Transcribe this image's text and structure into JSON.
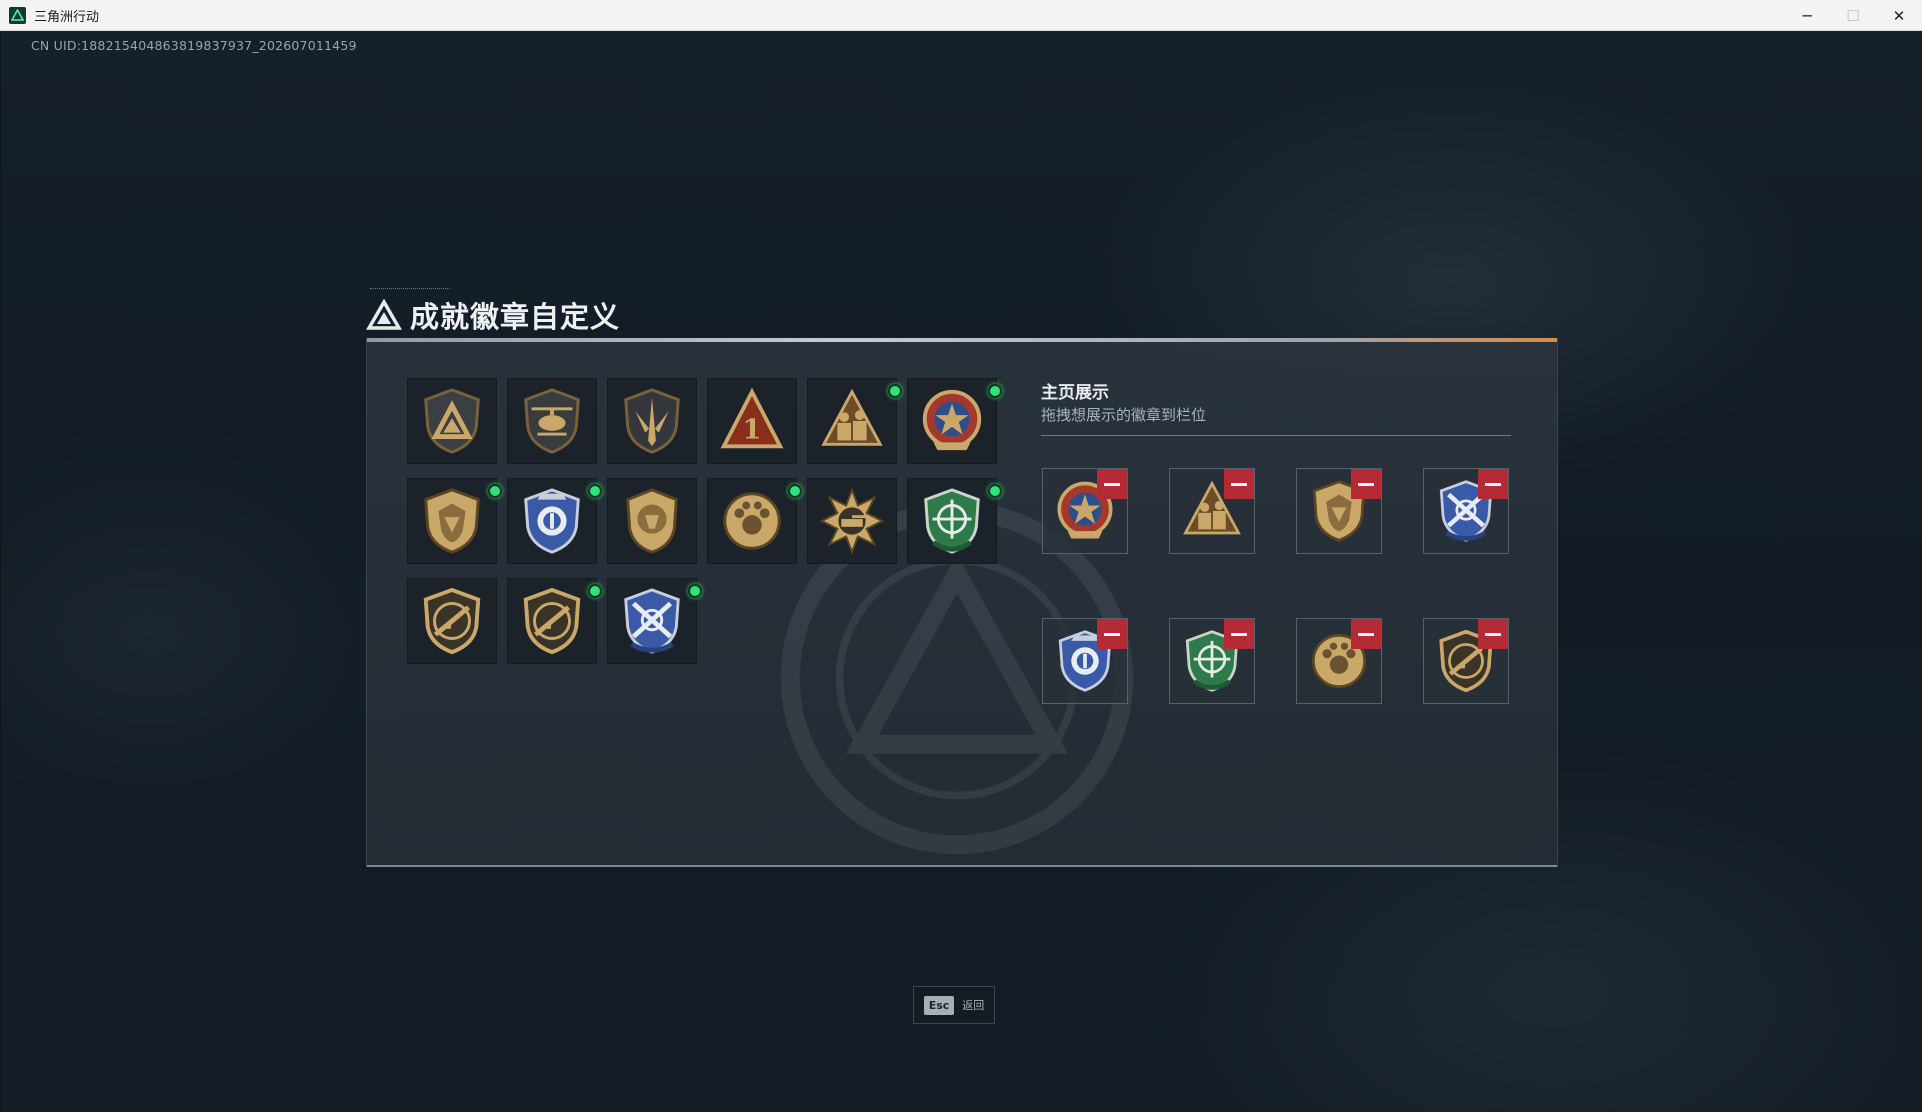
{
  "window": {
    "title": "三角洲行动",
    "minimize_glyph": "─",
    "maximize_glyph": "☐",
    "close_glyph": "✕"
  },
  "uid_text": "CN UID:18821540486381983793​7_202607011459",
  "dialog": {
    "title": "成就徽章自定义"
  },
  "showcase": {
    "title": "主页展示",
    "subtitle": "拖拽想展示的徽章到栏位",
    "slots": [
      {
        "badge": "star-eagle-badge",
        "icon": "star-medal-icon"
      },
      {
        "badge": "soldiers-triangle-badge",
        "icon": "soldiers-triangle-icon"
      },
      {
        "badge": "gold-shield-badge",
        "icon": "gold-shield-icon"
      },
      {
        "badge": "blue-crossed-rifles-badge",
        "icon": "blue-crossed-rifles-icon"
      },
      {
        "badge": "blue-police-badge",
        "icon": "blue-police-icon"
      },
      {
        "badge": "green-crosshair-badge",
        "icon": "green-crosshair-icon"
      },
      {
        "badge": "paw-medal-badge",
        "icon": "paw-medal-icon"
      },
      {
        "badge": "rifle-shield-badge",
        "icon": "rifle-shield-icon"
      }
    ]
  },
  "badges": [
    {
      "name": "delta-logo-badge",
      "icon": "delta-logo-icon",
      "new": false
    },
    {
      "name": "helicopter-badge",
      "icon": "helicopter-icon",
      "new": false
    },
    {
      "name": "blade-shield-badge",
      "icon": "blade-shield-icon",
      "new": false
    },
    {
      "name": "number-one-badge",
      "icon": "number-one-icon",
      "new": false
    },
    {
      "name": "soldiers-triangle-badge",
      "icon": "soldiers-triangle-icon",
      "new": true
    },
    {
      "name": "star-eagle-badge",
      "icon": "star-medal-icon",
      "new": true
    },
    {
      "name": "gold-shield-badge",
      "icon": "gold-shield-icon",
      "new": true
    },
    {
      "name": "blue-police-badge",
      "icon": "blue-police-icon",
      "new": true
    },
    {
      "name": "lion-shield-badge",
      "icon": "lion-shield-icon",
      "new": false
    },
    {
      "name": "paw-medal-badge",
      "icon": "paw-medal-icon",
      "new": true
    },
    {
      "name": "sun-tank-badge",
      "icon": "sun-tank-icon",
      "new": false
    },
    {
      "name": "green-crosshair-badge",
      "icon": "green-crosshair-icon",
      "new": true
    },
    {
      "name": "rifle-shield-badge",
      "icon": "rifle-shield-icon",
      "new": false
    },
    {
      "name": "rifle-shield-2-badge",
      "icon": "rifle-shield-icon",
      "new": true
    },
    {
      "name": "blue-crossed-rifles-badge",
      "icon": "blue-crossed-rifles-icon",
      "new": true
    }
  ],
  "footer": {
    "esc_key": "Esc",
    "esc_label": "返回"
  },
  "colors": {
    "gold": "#c9a86a",
    "new_dot": "#2fe27a",
    "remove": "#b52b35",
    "blue_badge": "#3a5aa8",
    "green_badge": "#2f7a4a"
  }
}
